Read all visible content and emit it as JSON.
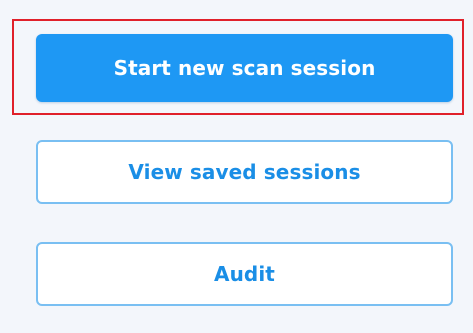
{
  "actions": {
    "start_scan_label": "Start new scan session",
    "view_saved_label": "View saved sessions",
    "audit_label": "Audit"
  },
  "colors": {
    "primary": "#1e98f4",
    "outline_border": "#79bff2",
    "outline_text": "#1a8ee6",
    "highlight": "#e0202a",
    "background": "#f3f6fb"
  }
}
